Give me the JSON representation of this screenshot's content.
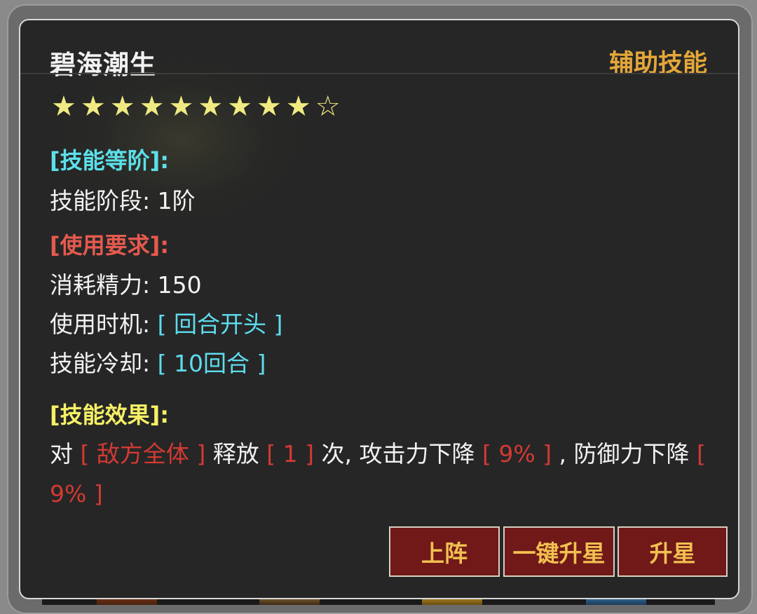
{
  "skill": {
    "name": "碧海潮生",
    "category": "辅助技能",
    "stars_filled": 9,
    "stars_total": 10
  },
  "rank_section": {
    "header": "[技能等阶]:",
    "label": "技能阶段:",
    "value": "1阶"
  },
  "requirement_section": {
    "header": "[使用要求]:",
    "energy_label": "消耗精力:",
    "energy_value": "150",
    "timing_label": "使用时机:",
    "timing_value": "[ 回合开头 ]",
    "cooldown_label": "技能冷却:",
    "cooldown_value": "[ 10回合 ]"
  },
  "effect_section": {
    "header": "[技能效果]:",
    "t1": "对",
    "target": "[ 敌方全体 ]",
    "t2": "释放",
    "times": "[ 1 ]",
    "t3": "次, 攻击力下降",
    "attack_down": "[ 9% ]",
    "t4": ", 防御力下降",
    "defense_down": "[ 9% ]"
  },
  "buttons": {
    "deploy": "上阵",
    "one_click_star_up": "一键升星",
    "star_up": "升星"
  },
  "colors": {
    "title": "#f2f2f2",
    "category": "#e5a73a",
    "star": "#f0ea82",
    "section_rank": "#5ce0ea",
    "section_requirement": "#e65a4e",
    "section_effect": "#f6f066",
    "value_highlight_cyan": "#5fdcee",
    "value_highlight_red": "#d23a33",
    "button_bg": "#711818",
    "button_text": "#f1c050"
  }
}
